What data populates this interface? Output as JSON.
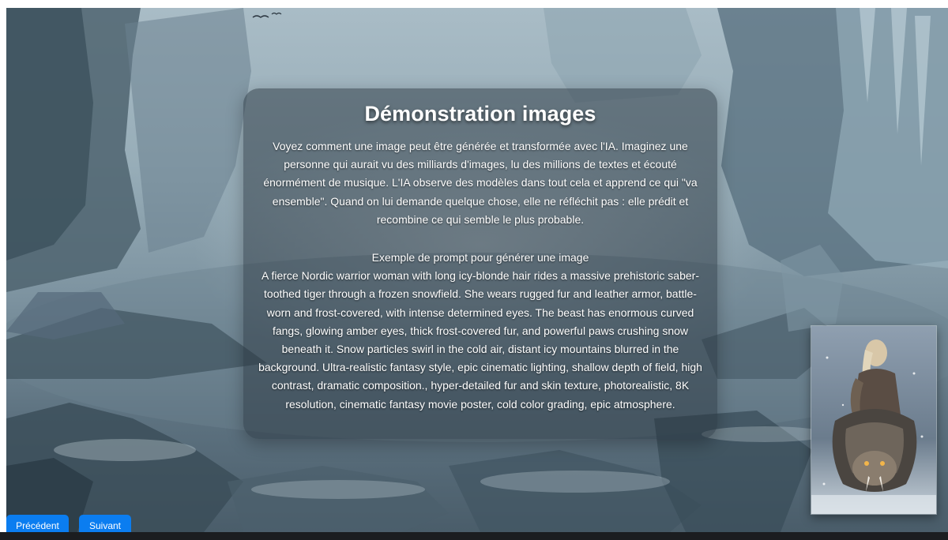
{
  "panel": {
    "title": "Démonstration images",
    "intro": "Voyez comment une image peut être générée et transformée avec l'IA. Imaginez une personne qui aurait vu des milliards d'images, lu des millions de textes et écouté énormément de musique. L'IA observe des modèles dans tout cela et apprend ce qui \"va ensemble\". Quand on lui demande quelque chose, elle ne réfléchit pas : elle prédit et recombine ce qui semble le plus probable.",
    "prompt_heading": "Exemple de prompt pour générer une image",
    "prompt_text": "A fierce Nordic warrior woman with long icy-blonde hair rides a massive prehistoric saber-toothed tiger through a frozen snowfield. She wears rugged fur and leather armor, battle-worn and frost-covered, with intense determined eyes. The beast has enormous curved fangs, glowing amber eyes, thick frost-covered fur, and powerful paws crushing snow beneath it. Snow particles swirl in the cold air, distant icy mountains blurred in the background. Ultra-realistic fantasy style, epic cinematic lighting, shallow depth of field, high contrast, dramatic composition., hyper-detailed fur and skin texture, photorealistic, 8K resolution, cinematic fantasy movie poster, cold color grading, epic atmosphere."
  },
  "navigation": {
    "previous_label": "Précédent",
    "next_label": "Suivant"
  },
  "colors": {
    "button_blue": "#0b7df0",
    "panel_overlay": "#28343e",
    "text": "#ffffff"
  },
  "icons": {
    "background": "frozen-landscape-image",
    "thumbnail": "warrior-sabertooth-image"
  }
}
